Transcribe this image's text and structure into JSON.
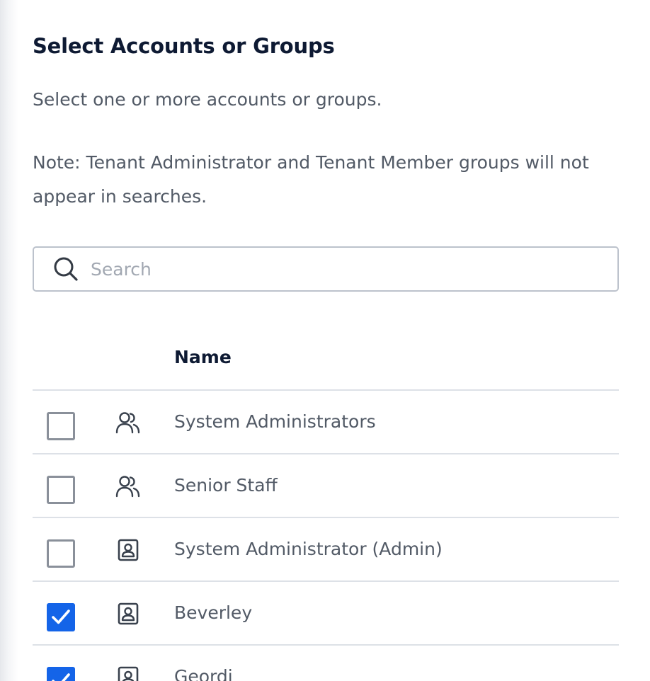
{
  "dialog": {
    "title": "Select Accounts or Groups",
    "subtitle": "Select one or more accounts or groups.",
    "note": "Note: Tenant Administrator and Tenant Member groups will not appear in searches."
  },
  "search": {
    "placeholder": "Search",
    "value": "",
    "icon": "search-icon"
  },
  "table": {
    "columns": [
      "",
      "",
      "Name"
    ],
    "rows": [
      {
        "name": "System Administrators",
        "type": "group",
        "icon": "group-icon",
        "checked": false
      },
      {
        "name": "Senior Staff",
        "type": "group",
        "icon": "group-icon",
        "checked": false
      },
      {
        "name": "System Administrator (Admin)",
        "type": "account",
        "icon": "user-badge-icon",
        "checked": false
      },
      {
        "name": "Beverley",
        "type": "account",
        "icon": "user-badge-icon",
        "checked": true
      },
      {
        "name": "Geordi",
        "type": "account",
        "icon": "user-badge-icon",
        "checked": true
      }
    ]
  },
  "colors": {
    "accent": "#1464e8",
    "title": "#0e1a33",
    "text": "#525a66",
    "border": "#dde1e7",
    "checkbox_border": "#8a909a",
    "placeholder": "#a2a8b2"
  }
}
